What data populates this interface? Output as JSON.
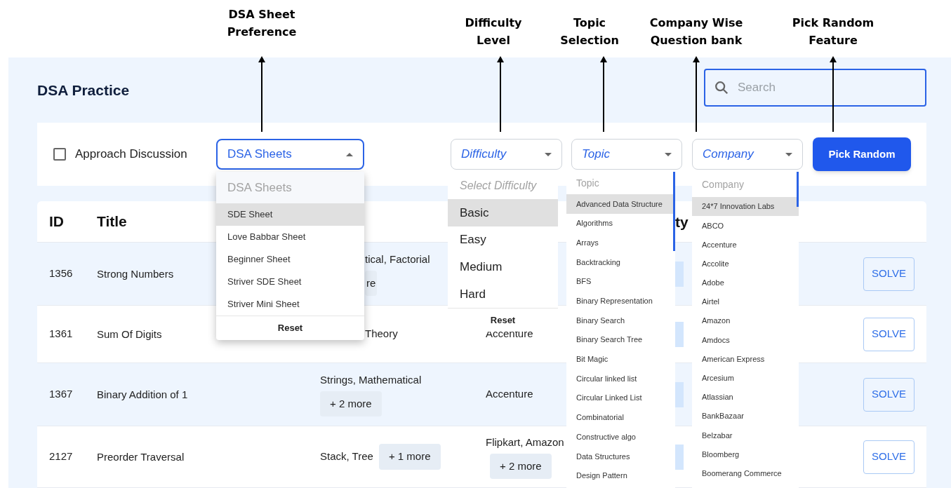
{
  "annotations": [
    {
      "label": "DSA Sheet\nPreference"
    },
    {
      "label": "Difficulty\nLevel"
    },
    {
      "label": "Topic\nSelection"
    },
    {
      "label": "Company Wise\nQuestion bank"
    },
    {
      "label": "Pick Random\nFeature"
    }
  ],
  "page": {
    "title": "DSA Practice",
    "search": {
      "placeholder": "Search"
    }
  },
  "filters": {
    "approach_discussion": {
      "label": "Approach Discussion",
      "checked": false
    },
    "selects": [
      {
        "text": "DSA Sheets",
        "focused": true,
        "italic": false
      },
      {
        "text": "Difficulty",
        "focused": false,
        "italic": true
      },
      {
        "text": "Topic",
        "focused": false,
        "italic": true
      },
      {
        "text": "Company",
        "focused": false,
        "italic": true
      }
    ],
    "pick_random": "Pick Random"
  },
  "menus": [
    {
      "kind": "sheets",
      "header": "DSA Sheets",
      "reset": "Reset",
      "items": [
        {
          "label": "SDE Sheet",
          "selected": true
        },
        {
          "label": "Love Babbar Sheet",
          "selected": false
        },
        {
          "label": "Beginner Sheet",
          "selected": false
        },
        {
          "label": "Striver SDE Sheet",
          "selected": false
        },
        {
          "label": "Striver Mini Sheet",
          "selected": false
        }
      ]
    },
    {
      "kind": "difficulty",
      "header": "Select Difficulty",
      "reset": "Reset",
      "items": [
        {
          "label": "Basic",
          "selected": true
        },
        {
          "label": "Easy",
          "selected": false
        },
        {
          "label": "Medium",
          "selected": false
        },
        {
          "label": "Hard",
          "selected": false
        }
      ]
    },
    {
      "kind": "topic",
      "header": "Topic",
      "items": [
        {
          "label": "Advanced Data Structure",
          "selected": true
        },
        {
          "label": "Algorithms",
          "selected": false
        },
        {
          "label": "Arrays",
          "selected": false
        },
        {
          "label": "Backtracking",
          "selected": false
        },
        {
          "label": "BFS",
          "selected": false
        },
        {
          "label": "Binary Representation",
          "selected": false
        },
        {
          "label": "Binary Search",
          "selected": false
        },
        {
          "label": "Binary Search Tree",
          "selected": false
        },
        {
          "label": "Bit Magic",
          "selected": false
        },
        {
          "label": "Circular linked list",
          "selected": false
        },
        {
          "label": "Circular Linked List",
          "selected": false
        },
        {
          "label": "Combinatorial",
          "selected": false
        },
        {
          "label": "Constructive algo",
          "selected": false
        },
        {
          "label": "Data Structures",
          "selected": false
        },
        {
          "label": "Design Pattern",
          "selected": false
        }
      ]
    },
    {
      "kind": "company",
      "header": "Company",
      "items": [
        {
          "label": "24*7 Innovation Labs",
          "selected": true
        },
        {
          "label": "ABCO",
          "selected": false
        },
        {
          "label": "Accenture",
          "selected": false
        },
        {
          "label": "Accolite",
          "selected": false
        },
        {
          "label": "Adobe",
          "selected": false
        },
        {
          "label": "Airtel",
          "selected": false
        },
        {
          "label": "Amazon",
          "selected": false
        },
        {
          "label": "Amdocs",
          "selected": false
        },
        {
          "label": "American Express",
          "selected": false
        },
        {
          "label": "Arcesium",
          "selected": false
        },
        {
          "label": "Atlassian",
          "selected": false
        },
        {
          "label": "BankBazaar",
          "selected": false
        },
        {
          "label": "Belzabar",
          "selected": false
        },
        {
          "label": "Bloomberg",
          "selected": false
        },
        {
          "label": "Boomerang Commerce",
          "selected": false
        }
      ]
    }
  ],
  "table": {
    "header": {
      "id": "ID",
      "title": "Title",
      "column_5": "ty"
    },
    "rows": [
      {
        "id": "1356",
        "title": "Strong Numbers",
        "topics": {
          "text": "tical, Factorial",
          "more": "re",
          "cut": true
        },
        "action": "SOLVE"
      },
      {
        "id": "1361",
        "title": "Sum Of Digits",
        "topics": {
          "text": "Theory",
          "cut": true
        },
        "companies": {
          "text": "Accenture"
        },
        "action": "SOLVE"
      },
      {
        "id": "1367",
        "title": "Binary Addition of 1",
        "topics": {
          "text": "Strings, Mathematical",
          "more": "+ 2 more"
        },
        "companies": {
          "text": "Accenture"
        },
        "action": "SOLVE"
      },
      {
        "id": "2127",
        "title": "Preorder Traversal",
        "topics": {
          "text": "Stack, Tree",
          "more": "+ 1 more"
        },
        "companies": {
          "text": "Flipkart, Amazon",
          "more": "+ 2 more"
        },
        "action": "SOLVE"
      }
    ]
  }
}
